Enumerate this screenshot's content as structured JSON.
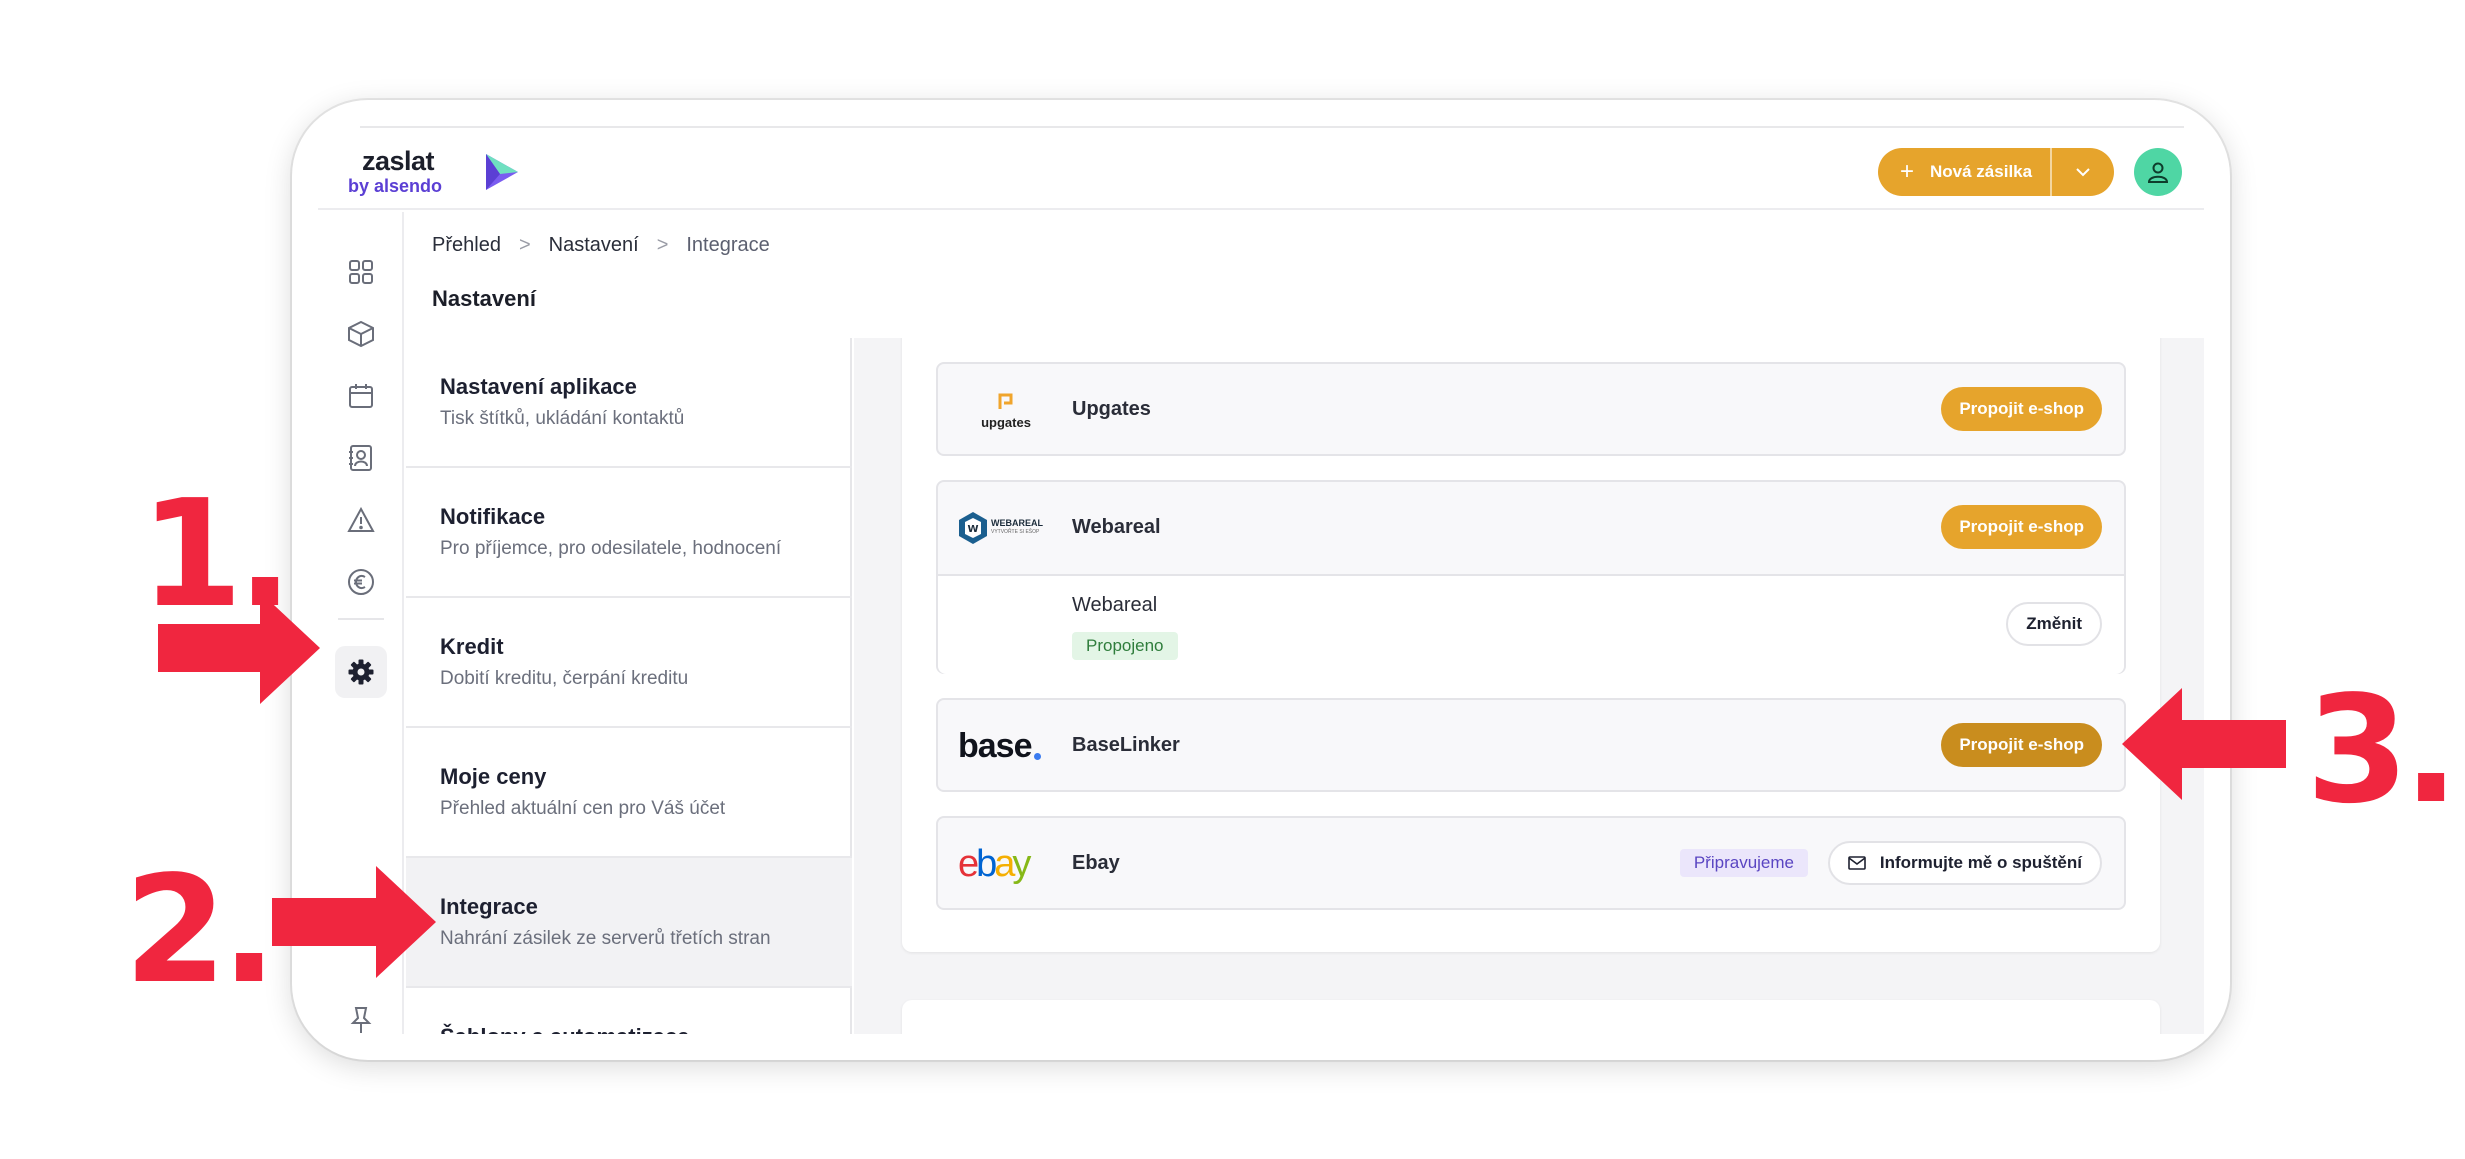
{
  "app": {
    "logo_word": "zaslat",
    "logo_sub": "by alsendo",
    "new_shipment": "Nová zásilka",
    "plus": "+",
    "colors": {
      "accent": "#e6a42c",
      "brand_purple": "#5b3fd4",
      "avatar": "#4fd6a4",
      "annotation": "#f0263f"
    }
  },
  "rail": {
    "icons": [
      "grid-icon",
      "package-icon",
      "calendar-icon",
      "contacts-icon",
      "warning-icon",
      "euro-icon",
      "gear-icon",
      "pin-icon"
    ],
    "active": "gear-icon"
  },
  "breadcrumb": {
    "home": "Přehled",
    "settings": "Nastavení",
    "current": "Integrace",
    "separator": ">"
  },
  "page": {
    "title": "Nastavení"
  },
  "menu": {
    "items": [
      {
        "title": "Nastavení aplikace",
        "subtitle": "Tisk štítků, ukládání kontaktů"
      },
      {
        "title": "Notifikace",
        "subtitle": "Pro příjemce, pro odesilatele, hodnocení"
      },
      {
        "title": "Kredit",
        "subtitle": "Dobití kreditu, čerpání kreditu"
      },
      {
        "title": "Moje ceny",
        "subtitle": "Přehled aktuální cen pro Váš účet"
      },
      {
        "title": "Integrace",
        "subtitle": "Nahrání zásilek ze serverů třetích stran"
      },
      {
        "title": "Šablony a automatizace",
        "subtitle": ""
      }
    ],
    "active_index": 4
  },
  "integrations": {
    "upgates": {
      "logo_text": "upgates",
      "name": "Upgates",
      "button": "Propojit e-shop"
    },
    "webareal": {
      "logo_text": "WEBAREAL",
      "logo_tagline": "VYTVOŘTE SI EŠOP",
      "name": "Webareal",
      "button": "Propojit e-shop",
      "connected_name": "Webareal",
      "status": "Propojeno",
      "change_button": "Změnit"
    },
    "baselinker": {
      "logo_text": "base",
      "name": "BaseLinker",
      "button": "Propojit e-shop"
    },
    "ebay": {
      "logo_letters": [
        "e",
        "b",
        "a",
        "y"
      ],
      "name": "Ebay",
      "badge": "Připravujeme",
      "notify_button": "Informujte mě o spuštění"
    }
  },
  "annotations": {
    "step1": "1.",
    "step2": "2.",
    "step3": "3."
  }
}
